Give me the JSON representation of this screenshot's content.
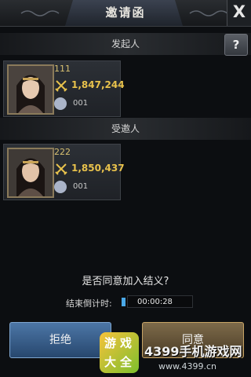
{
  "dialog": {
    "title": "邀请函",
    "close_label": "X"
  },
  "initiator": {
    "section_label": "发起人",
    "help_label": "?",
    "name": "111",
    "power": "1,847,244",
    "guild": "001"
  },
  "invitee": {
    "section_label": "受邀人",
    "name": "222",
    "power": "1,850,437",
    "guild": "001"
  },
  "prompt": {
    "question": "是否同意加入结义?",
    "countdown_label": "结束倒计时:",
    "countdown_value": "00:00:28"
  },
  "buttons": {
    "reject_label": "拒绝",
    "agree_label": "同意"
  },
  "watermark": {
    "tile_chars": [
      "游",
      "戏",
      "大",
      "全"
    ],
    "site_name": "4399手机游戏网",
    "site_url": "www.4399.cn"
  }
}
